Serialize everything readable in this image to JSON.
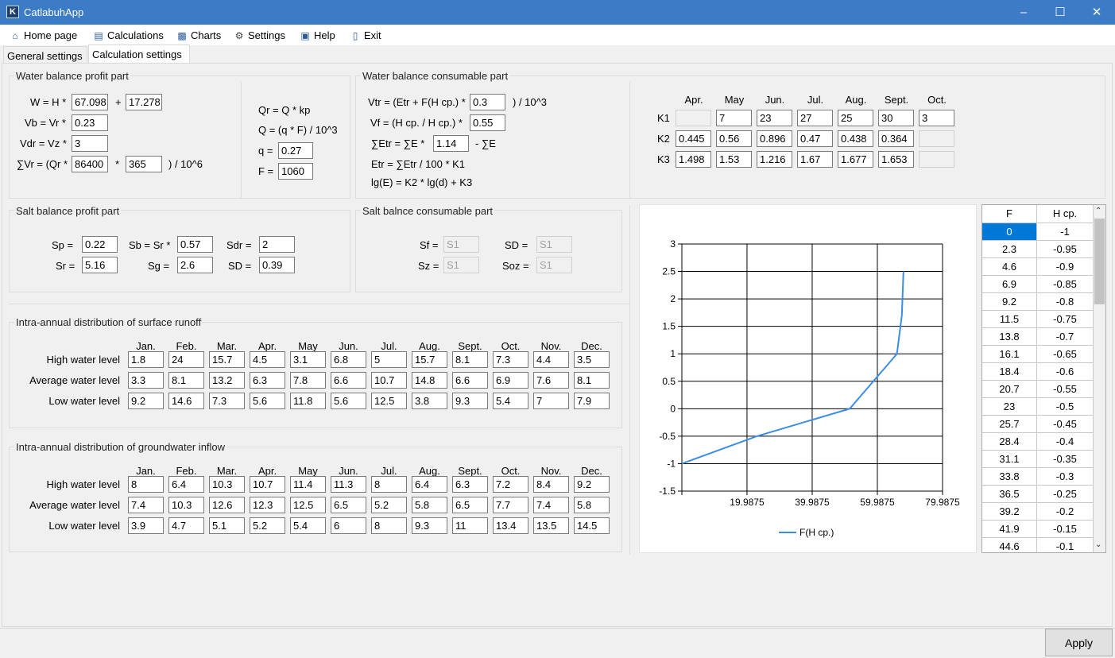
{
  "app": {
    "title": "CatlabuhApp",
    "icon_letter": "K"
  },
  "menu": {
    "home": "Home page",
    "calculations": "Calculations",
    "charts": "Charts",
    "settings": "Settings",
    "help": "Help",
    "exit": "Exit"
  },
  "tabs": {
    "general": "General settings",
    "calc": "Calculation settings"
  },
  "wbp": {
    "title": "Water balance profit part",
    "w_label": "W = H *",
    "w1": "67.098",
    "plus": "+",
    "w2": "17.278",
    "vb_label": "Vb = Vr *",
    "vb": "0.23",
    "vdr_label": "Vdr = Vz *",
    "vdr": "3",
    "svr_label": "∑Vr = (Qr *",
    "svr1": "86400",
    "star": "*",
    "svr2": "365",
    "svr_suffix": ") / 10^6",
    "qr_formula": "Qr = Q * kp",
    "q_formula": "Q = (q * F) / 10^3",
    "q_label": "q =",
    "q": "0.27",
    "f_label": "F =",
    "f": "1060"
  },
  "wbc": {
    "title": "Water balance consumable part",
    "vtr_label": "Vtr = (Etr + F(H cp.) *",
    "vtr": "0.3",
    "vtr_suffix": ") / 10^3",
    "vf_label": "Vf = (H cp.  / H cp.) *",
    "vf": "0.55",
    "setr_label": "∑Etr = ∑E *",
    "setr": "1.14",
    "setr_suffix": "- ∑E",
    "etr_formula": "Etr = ∑Etr / 100 * K1",
    "lge_formula": "lg(E) = K2 * lg(d) + K3"
  },
  "kt": {
    "months": [
      "Apr.",
      "May",
      "Jun.",
      "Jul.",
      "Aug.",
      "Sept.",
      "Oct."
    ],
    "rows": [
      {
        "label": "K1",
        "values": [
          "",
          "7",
          "23",
          "27",
          "25",
          "30",
          "3"
        ]
      },
      {
        "label": "K2",
        "values": [
          "0.445",
          "0.56",
          "0.896",
          "0.47",
          "0.438",
          "0.364",
          ""
        ]
      },
      {
        "label": "K3",
        "values": [
          "1.498",
          "1.53",
          "1.216",
          "1.67",
          "1.677",
          "1.653",
          ""
        ]
      }
    ]
  },
  "sbp": {
    "title": "Salt balance profit part",
    "sp_label": "Sp =",
    "sp": "0.22",
    "sb_label": "Sb = Sr *",
    "sb": "0.57",
    "sdr_label": "Sdr =",
    "sdr": "2",
    "sr_label": "Sr =",
    "sr": "5.16",
    "sg_label": "Sg =",
    "sg": "2.6",
    "sd_label": "SD =",
    "sd": "0.39"
  },
  "sbc": {
    "title": "Salt balnce consumable part",
    "sf_label": "Sf =",
    "sf": "S1",
    "sd_label": "SD =",
    "sd": "S1",
    "sz_label": "Sz =",
    "sz": "S1",
    "soz_label": "Soz =",
    "soz": "S1"
  },
  "months12": [
    "Jan.",
    "Feb.",
    "Mar.",
    "Apr.",
    "May",
    "Jun.",
    "Jul.",
    "Aug.",
    "Sept.",
    "Oct.",
    "Nov.",
    "Dec."
  ],
  "surface": {
    "title": "Intra-annual distribution of surface runoff",
    "rows": [
      {
        "label": "High water level",
        "values": [
          "1.8",
          "24",
          "15.7",
          "4.5",
          "3.1",
          "6.8",
          "5",
          "15.7",
          "8.1",
          "7.3",
          "4.4",
          "3.5"
        ]
      },
      {
        "label": "Average water level",
        "values": [
          "3.3",
          "8.1",
          "13.2",
          "6.3",
          "7.8",
          "6.6",
          "10.7",
          "14.8",
          "6.6",
          "6.9",
          "7.6",
          "8.1"
        ]
      },
      {
        "label": "Low water level",
        "values": [
          "9.2",
          "14.6",
          "7.3",
          "5.6",
          "11.8",
          "5.6",
          "12.5",
          "3.8",
          "9.3",
          "5.4",
          "7",
          "7.9"
        ]
      }
    ]
  },
  "ground": {
    "title": "Intra-annual distribution of groundwater inflow",
    "rows": [
      {
        "label": "High water level",
        "values": [
          "8",
          "6.4",
          "10.3",
          "10.7",
          "11.4",
          "11.3",
          "8",
          "6.4",
          "6.3",
          "7.2",
          "8.4",
          "9.2"
        ]
      },
      {
        "label": "Average water level",
        "values": [
          "7.4",
          "10.3",
          "12.6",
          "12.3",
          "12.5",
          "6.5",
          "5.2",
          "5.8",
          "6.5",
          "7.7",
          "7.4",
          "5.8"
        ]
      },
      {
        "label": "Low water level",
        "values": [
          "3.9",
          "4.7",
          "5.1",
          "5.2",
          "5.4",
          "6",
          "8",
          "9.3",
          "11",
          "13.4",
          "13.5",
          "14.5"
        ]
      }
    ]
  },
  "chart_data": {
    "type": "line",
    "series": [
      {
        "name": "F(H cp.)",
        "color": "#3c8de8",
        "points": [
          [
            0,
            -1
          ],
          [
            23,
            -0.5
          ],
          [
            51.5,
            0
          ],
          [
            66,
            1
          ],
          [
            67.5,
            1.7
          ],
          [
            68,
            2.5
          ]
        ]
      }
    ],
    "xlim": [
      0,
      79.9875
    ],
    "xticks": [
      "19.9875",
      "39.9875",
      "59.9875",
      "79.9875"
    ],
    "xtick_values": [
      19.9875,
      39.9875,
      59.9875,
      79.9875
    ],
    "ylim": [
      -1.5,
      3
    ],
    "yticks": [
      "3",
      "2.5",
      "2",
      "1.5",
      "1",
      "0.5",
      "0",
      "-0.5",
      "-1",
      "-1.5"
    ],
    "ytick_values": [
      3,
      2.5,
      2,
      1.5,
      1,
      0.5,
      0,
      -0.5,
      -1,
      -1.5
    ],
    "grid": true,
    "legend": "bottom"
  },
  "grid": {
    "headers": [
      "F",
      "H cp."
    ],
    "rows": [
      [
        "0",
        "-1"
      ],
      [
        "2.3",
        "-0.95"
      ],
      [
        "4.6",
        "-0.9"
      ],
      [
        "6.9",
        "-0.85"
      ],
      [
        "9.2",
        "-0.8"
      ],
      [
        "11.5",
        "-0.75"
      ],
      [
        "13.8",
        "-0.7"
      ],
      [
        "16.1",
        "-0.65"
      ],
      [
        "18.4",
        "-0.6"
      ],
      [
        "20.7",
        "-0.55"
      ],
      [
        "23",
        "-0.5"
      ],
      [
        "25.7",
        "-0.45"
      ],
      [
        "28.4",
        "-0.4"
      ],
      [
        "31.1",
        "-0.35"
      ],
      [
        "33.8",
        "-0.3"
      ],
      [
        "36.5",
        "-0.25"
      ],
      [
        "39.2",
        "-0.2"
      ],
      [
        "41.9",
        "-0.15"
      ],
      [
        "44.6",
        "-0.1"
      ]
    ]
  },
  "footer": {
    "apply": "Apply"
  }
}
